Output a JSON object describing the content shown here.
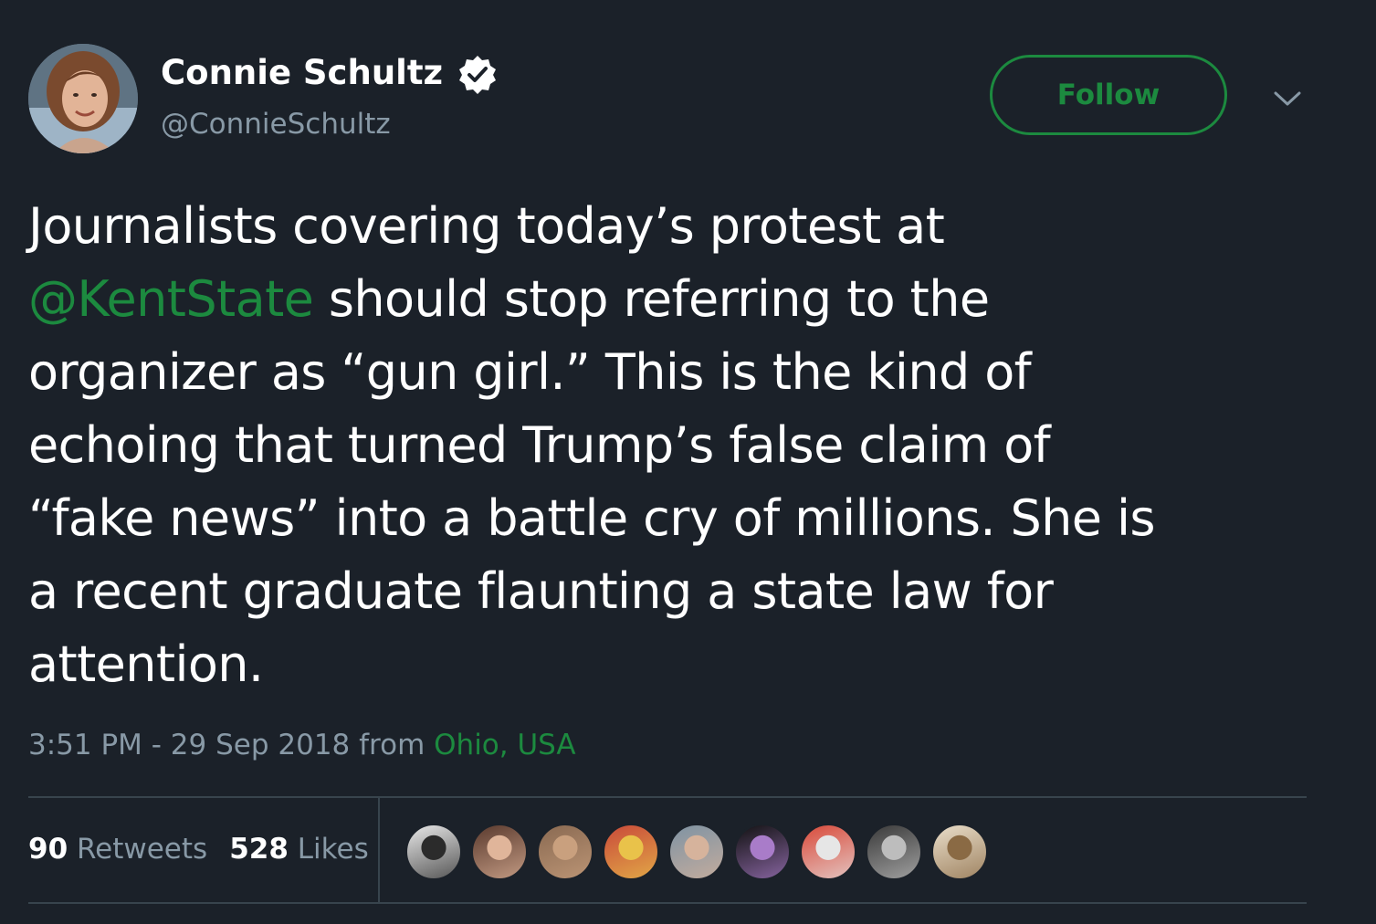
{
  "user": {
    "display_name": "Connie Schultz",
    "handle": "@ConnieSchultz",
    "verified": true,
    "avatar_icon": "profile-photo"
  },
  "header": {
    "follow_label": "Follow",
    "menu_icon": "chevron-down-icon"
  },
  "tweet": {
    "lines": [
      {
        "text": "Journalists covering today’s protest at"
      },
      {
        "mention": "@KentState",
        "text": " should stop referring to the"
      },
      {
        "text": "organizer as “gun girl.” This is the kind of"
      },
      {
        "text": "echoing that turned Trump’s false claim of"
      },
      {
        "text": "“fake news” into a battle cry of millions. She is"
      },
      {
        "text": "a recent graduate flaunting a state law for"
      },
      {
        "text": "attention."
      }
    ]
  },
  "meta": {
    "time": "3:51 PM - 29 Sep 2018 from ",
    "location": "Ohio, USA"
  },
  "stats": {
    "retweets_count": "90",
    "retweets_label": " Retweets",
    "likes_count": "528",
    "likes_label": " Likes"
  },
  "likers": [
    {
      "name": "liker-avatar-1",
      "colors": [
        "#e8e8e8",
        "#2b2b2b"
      ]
    },
    {
      "name": "liker-avatar-2",
      "colors": [
        "#5a3a2e",
        "#e0b59a"
      ]
    },
    {
      "name": "liker-avatar-3",
      "colors": [
        "#8a6a52",
        "#c9a07e"
      ]
    },
    {
      "name": "liker-avatar-4",
      "colors": [
        "#c94a3a",
        "#e9c24a"
      ]
    },
    {
      "name": "liker-avatar-5",
      "colors": [
        "#7f93a3",
        "#d6b39c"
      ]
    },
    {
      "name": "liker-avatar-6",
      "colors": [
        "#121212",
        "#a97cc9"
      ]
    },
    {
      "name": "liker-avatar-7",
      "colors": [
        "#d94a3a",
        "#e6e6e6"
      ]
    },
    {
      "name": "liker-avatar-8",
      "colors": [
        "#3a3a3a",
        "#bdbdbd"
      ]
    },
    {
      "name": "liker-avatar-9",
      "colors": [
        "#e9ddc9",
        "#8a6a44"
      ]
    }
  ],
  "colors": {
    "background": "#1b2129",
    "accent": "#1c8a3f",
    "secondary_text": "#8899a6",
    "divider": "#38444d"
  }
}
